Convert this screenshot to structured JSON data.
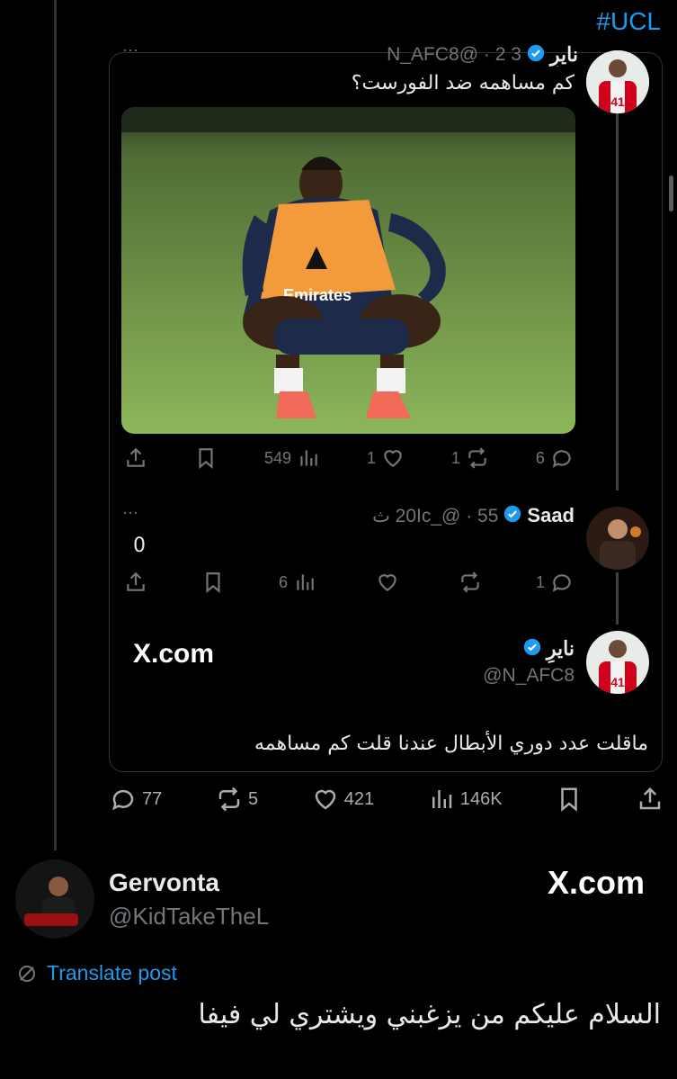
{
  "hashtag": "#UCL",
  "quoted_tweet": {
    "author_name": "نايرِ",
    "meta": "3 2 · @N_AFC8",
    "text": "كم مساهمه ضد الفورست؟",
    "more": "···",
    "stats": {
      "replies": "6",
      "reposts": "1",
      "likes": "1",
      "views": "549"
    }
  },
  "reply": {
    "author_name": "Saad",
    "meta": "55 · @_20Ic ث",
    "text": "0",
    "more": "···",
    "stats": {
      "replies": "1",
      "reposts": "",
      "likes": "",
      "views": "6"
    }
  },
  "nested_quote": {
    "author_name": "نايرِ",
    "handle": "@N_AFC8",
    "source": "X.com",
    "text": "ماقلت عدد دوري الأبطال عندنا قلت كم مساهمه"
  },
  "main_stats": {
    "replies": "77",
    "reposts": "5",
    "likes": "421",
    "views": "146K"
  },
  "bottom_post": {
    "author_name": "Gervonta",
    "handle": "@KidTakeTheL",
    "source": "X.com",
    "translate": "Translate post",
    "text": "السلام عليكم من يزغبني ويشتري لي فيفا"
  },
  "colors": {
    "accent": "#1d9bf0",
    "muted": "#71767b",
    "background": "#000000"
  }
}
